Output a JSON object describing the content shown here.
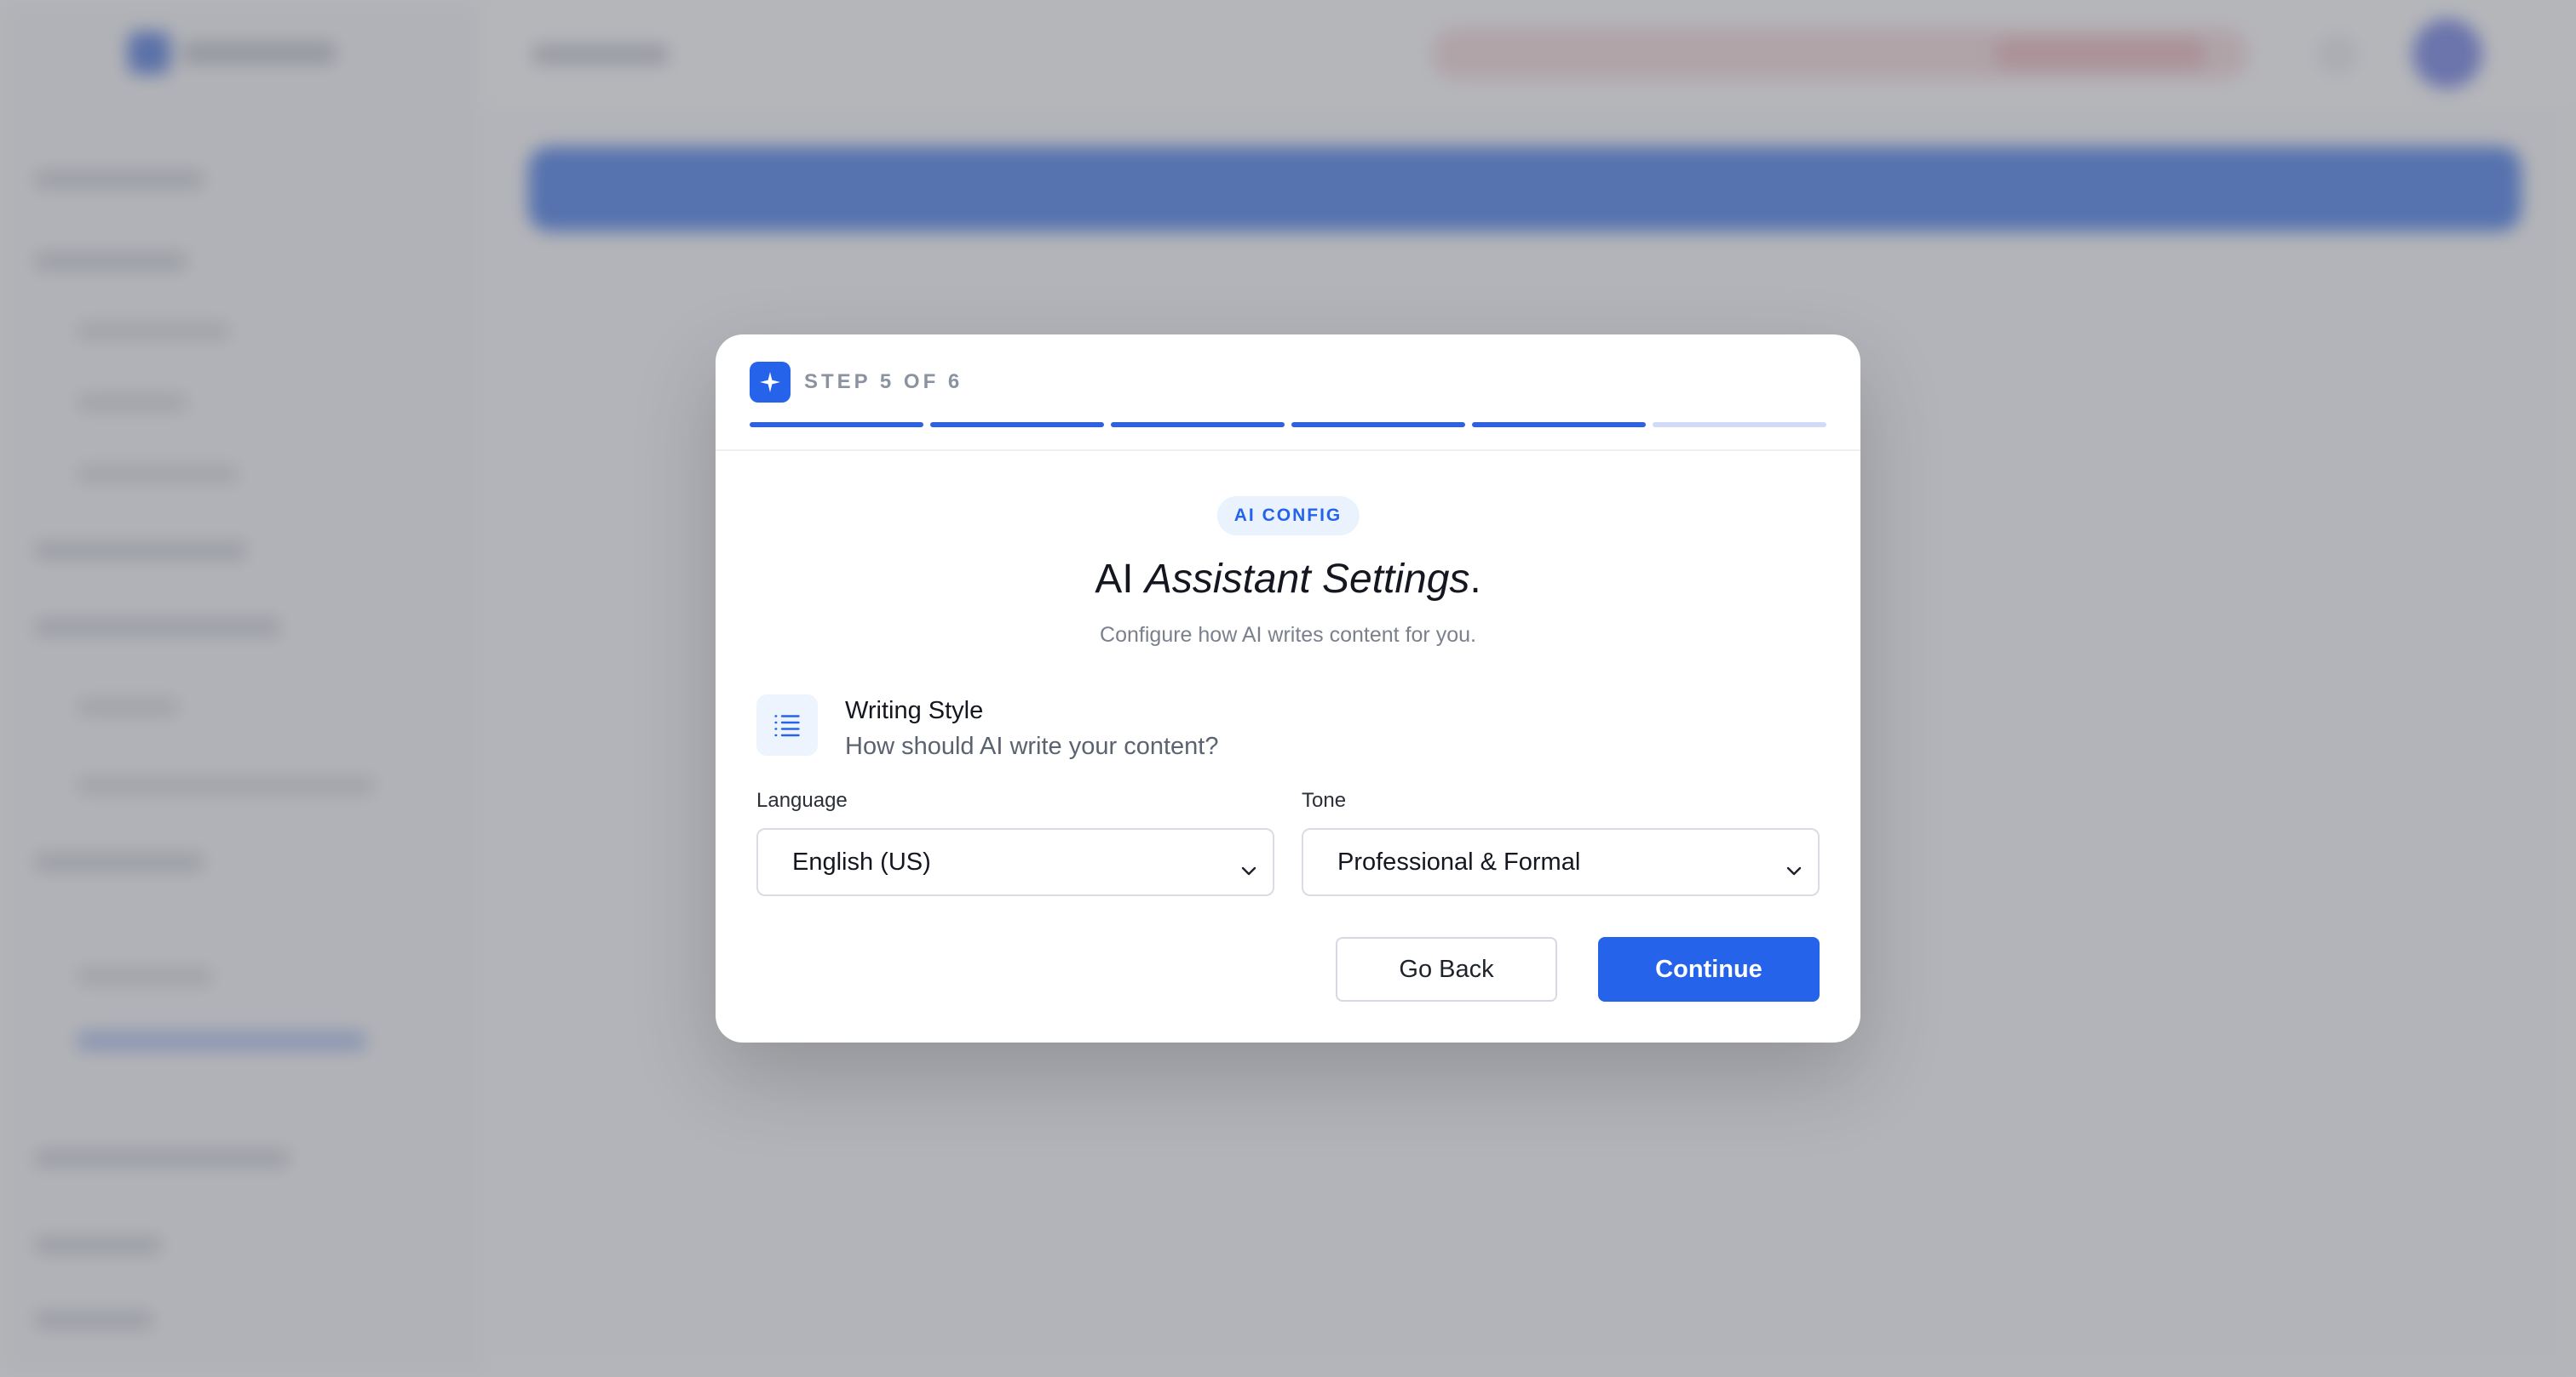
{
  "modal": {
    "step_label": "STEP 5 OF 6",
    "step_icon": "sparkle-icon",
    "progress": {
      "current": 5,
      "total": 6
    },
    "badge": "AI CONFIG",
    "title_plain": "AI ",
    "title_italic": "Assistant Settings",
    "title_end": ".",
    "subtitle": "Configure how AI writes content for you.",
    "section": {
      "icon": "list-icon",
      "title": "Writing Style",
      "subtitle": "How should AI write your content?"
    },
    "language": {
      "label": "Language",
      "value": "English (US)"
    },
    "tone": {
      "label": "Tone",
      "value": "Professional & Formal"
    },
    "buttons": {
      "back": "Go Back",
      "continue": "Continue"
    }
  },
  "colors": {
    "accent": "#2563eb",
    "progress_done": "#2f62dc",
    "progress_todo": "#cfdbf7",
    "badge_bg": "#eaf2fd"
  }
}
